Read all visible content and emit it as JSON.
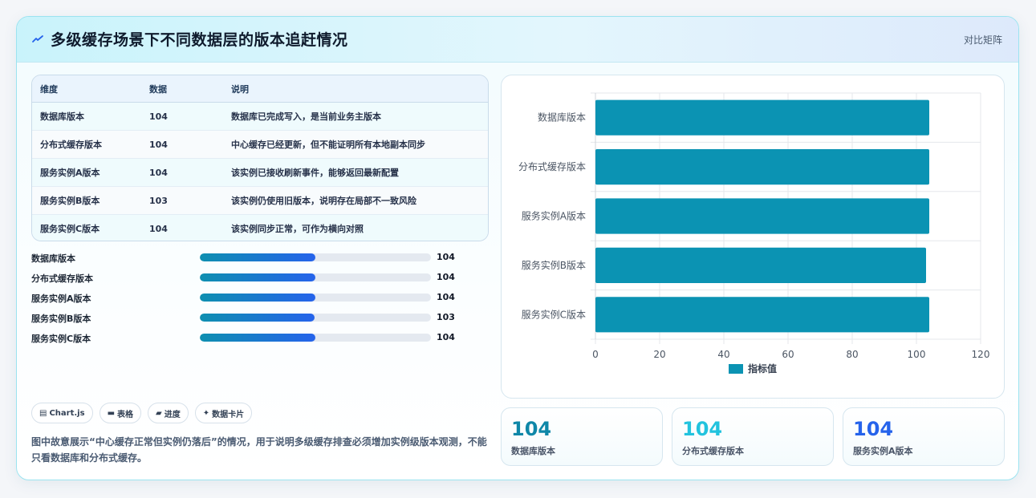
{
  "header": {
    "title": "多级缓存场景下不同数据层的版本追赶情况",
    "right_label": "对比矩阵",
    "icon": "zigzag-icon"
  },
  "table": {
    "headers": [
      "维度",
      "数据",
      "说明"
    ],
    "rows": [
      [
        "数据库版本",
        "104",
        "数据库已完成写入，是当前业务主版本"
      ],
      [
        "分布式缓存版本",
        "104",
        "中心缓存已经更新，但不能证明所有本地副本同步"
      ],
      [
        "服务实例A版本",
        "104",
        "该实例已接收刷新事件，能够返回最新配置"
      ],
      [
        "服务实例B版本",
        "103",
        "该实例仍使用旧版本，说明存在局部不一致风险"
      ],
      [
        "服务实例C版本",
        "104",
        "该实例同步正常，可作为横向对照"
      ]
    ]
  },
  "progress": {
    "max": 208,
    "items": [
      {
        "label": "数据库版本",
        "value": "104"
      },
      {
        "label": "分布式缓存版本",
        "value": "104"
      },
      {
        "label": "服务实例A版本",
        "value": "104"
      },
      {
        "label": "服务实例B版本",
        "value": "103"
      },
      {
        "label": "服务实例C版本",
        "value": "104"
      }
    ]
  },
  "tags": [
    {
      "icon": "▤",
      "label": "Chart.js"
    },
    {
      "icon": "▬",
      "label": "表格"
    },
    {
      "icon": "▰",
      "label": "进度"
    },
    {
      "icon": "✦",
      "label": "数据卡片"
    }
  ],
  "note": "图中故意展示“中心缓存正常但实例仍落后”的情况，用于说明多级缓存排查必须增加实例级版本观测，不能只看数据库和分布式缓存。",
  "stats": [
    {
      "value": "104",
      "label": "数据库版本",
      "color": "#0e87a8"
    },
    {
      "value": "104",
      "label": "分布式缓存版本",
      "color": "#22c3de"
    },
    {
      "value": "104",
      "label": "服务实例A版本",
      "color": "#2563eb"
    }
  ],
  "chart_data": {
    "type": "bar",
    "orientation": "horizontal",
    "categories": [
      "数据库版本",
      "分布式缓存版本",
      "服务实例A版本",
      "服务实例B版本",
      "服务实例C版本"
    ],
    "series": [
      {
        "name": "指标值",
        "values": [
          104,
          104,
          104,
          103,
          104
        ]
      }
    ],
    "xlim": [
      0,
      120
    ],
    "xticks": [
      "0",
      "20",
      "40",
      "60",
      "80",
      "100",
      "120"
    ],
    "grid": true,
    "legend": "bottom",
    "bar_color": "#0b93b3"
  }
}
